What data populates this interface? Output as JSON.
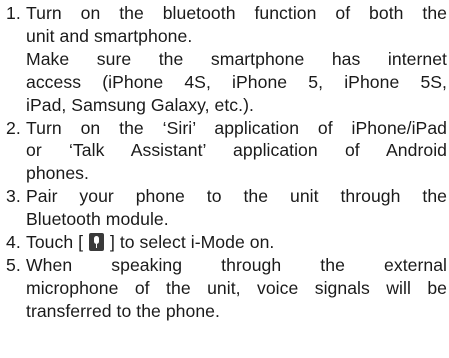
{
  "steps": [
    {
      "number": "1.",
      "lines": [
        "Turn on the bluetooth function of both the",
        "unit and smartphone.",
        "Make sure the smartphone has internet",
        "access (iPhone 4S, iPhone 5, iPhone 5S,",
        "iPad, Samsung Galaxy, etc.)."
      ]
    },
    {
      "number": "2.",
      "lines": [
        "Turn on the ‘Siri’ application of iPhone/iPad",
        "or ‘Talk Assistant’ application of Android",
        "phones."
      ]
    },
    {
      "number": "3.",
      "lines": [
        "Pair your phone to the unit through the",
        "Bluetooth module."
      ]
    },
    {
      "number": "4.",
      "before_icon": "Touch [ ",
      "icon": "microphone-icon",
      "after_icon": " ] to select i-Mode on."
    },
    {
      "number": "5.",
      "lines": [
        "When speaking through the external",
        "microphone of the unit, voice signals will be",
        "transferred to the phone."
      ]
    }
  ]
}
